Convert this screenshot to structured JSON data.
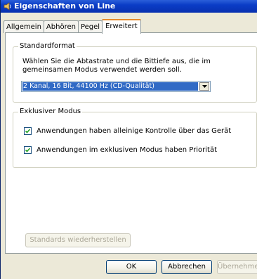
{
  "window": {
    "title": "Eigenschaften von Line",
    "icon": "speaker-icon"
  },
  "tabs": [
    {
      "label": "Allgemein",
      "active": false
    },
    {
      "label": "Abhören",
      "active": false
    },
    {
      "label": "Pegel",
      "active": false
    },
    {
      "label": "Erweitert",
      "active": true
    }
  ],
  "standardformat": {
    "legend": "Standardformat",
    "description": "Wählen Sie die Abtastrate und die Bittiefe aus, die im gemeinsamen Modus verwendet werden soll.",
    "selected": "2 Kanal, 16 Bit, 44100 Hz (CD-Qualität)"
  },
  "exclusive": {
    "legend": "Exklusiver Modus",
    "options": [
      {
        "label": "Anwendungen haben alleinige Kontrolle über das Gerät",
        "checked": true
      },
      {
        "label": "Anwendungen im exklusiven Modus haben Priorität",
        "checked": true
      }
    ]
  },
  "buttons": {
    "restore": "Standards wiederherstellen",
    "ok": "OK",
    "cancel": "Abbrechen",
    "apply": "Übernehmen"
  },
  "colors": {
    "titlebar": "#0a3cc6",
    "selection": "#316ac5",
    "active_tab_accent": "#e68b2c"
  }
}
